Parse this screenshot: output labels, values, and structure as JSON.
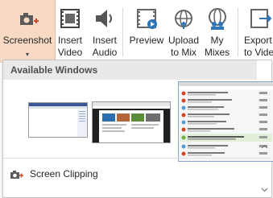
{
  "ribbon": {
    "screenshot": {
      "label": "Screenshot",
      "dropdown": "▾",
      "icon": "camera-plus-icon"
    },
    "insert_video": {
      "line1": "Insert",
      "line2": "Video",
      "icon": "film-icon"
    },
    "insert_audio": {
      "line1": "Insert",
      "line2": "Audio",
      "icon": "speaker-icon"
    },
    "preview": {
      "label": "Preview",
      "icon": "film-play-icon"
    },
    "upload": {
      "line1": "Upload",
      "line2": "to Mix",
      "icon": "globe-upload-icon"
    },
    "my_mixes": {
      "line1": "My",
      "line2": "Mixes",
      "icon": "globe-users-icon"
    },
    "export": {
      "line1": "Export",
      "line2": "to Video",
      "icon": "export-video-icon"
    }
  },
  "dropdown": {
    "header": "Available Windows",
    "clipping_label": "Screen Clipping"
  },
  "colors": {
    "accent": "#d24726",
    "selected_bg": "#f7d9c4",
    "icon_blue": "#2e75b6"
  }
}
